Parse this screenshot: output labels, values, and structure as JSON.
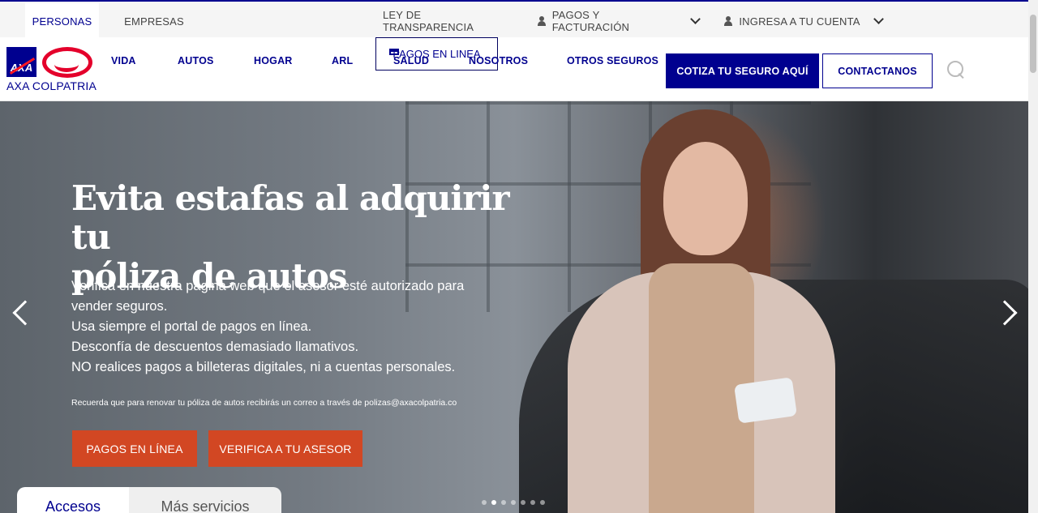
{
  "topbar": {
    "personas": "PERSONAS",
    "empresas": "EMPRESAS",
    "ley": "LEY DE TRANSPARENCIA",
    "pagos_facturacion": "PAGOS Y FACTURACIÓN",
    "ingresa": "INGRESA A TU CUENTA"
  },
  "logo": {
    "text": "AXA COLPATRIA",
    "mark": "AXA"
  },
  "nav": {
    "items": [
      "VIDA",
      "AUTOS",
      "HOGAR",
      "ARL",
      "SALUD",
      "NOSOTROS",
      "OTROS SEGUROS"
    ],
    "pagos_en_linea": "PAGOS EN LINEA",
    "cotiza": "COTIZA TU SEGURO AQUÍ",
    "contactanos": "CONTACTANOS"
  },
  "hero": {
    "title_line1": "Evita estafas al adquirir tu",
    "title_line2": "póliza de autos",
    "lines": [
      "Verifica en nuestra página web que el asesor esté autorizado para",
      "vender seguros.",
      "Usa siempre el portal de pagos en línea.",
      "Desconfía de descuentos demasiado llamativos.",
      "NO realices pagos a billeteras digitales, ni a cuentas personales."
    ],
    "note": "Recuerda que para renovar tu póliza de autos recibirás un correo a través de polizas@axacolpatria.co",
    "cta_pagos": "PAGOS EN LÍNEA",
    "cta_asesor": "VERIFICA A TU ASESOR",
    "slides": 7,
    "active_slide": 2
  },
  "tabs": {
    "accesos": "Accesos",
    "mas_servicios": "Más servicios"
  },
  "colors": {
    "brand": "#00008f",
    "cta": "#d24723",
    "logo_red": "#e4002b"
  }
}
